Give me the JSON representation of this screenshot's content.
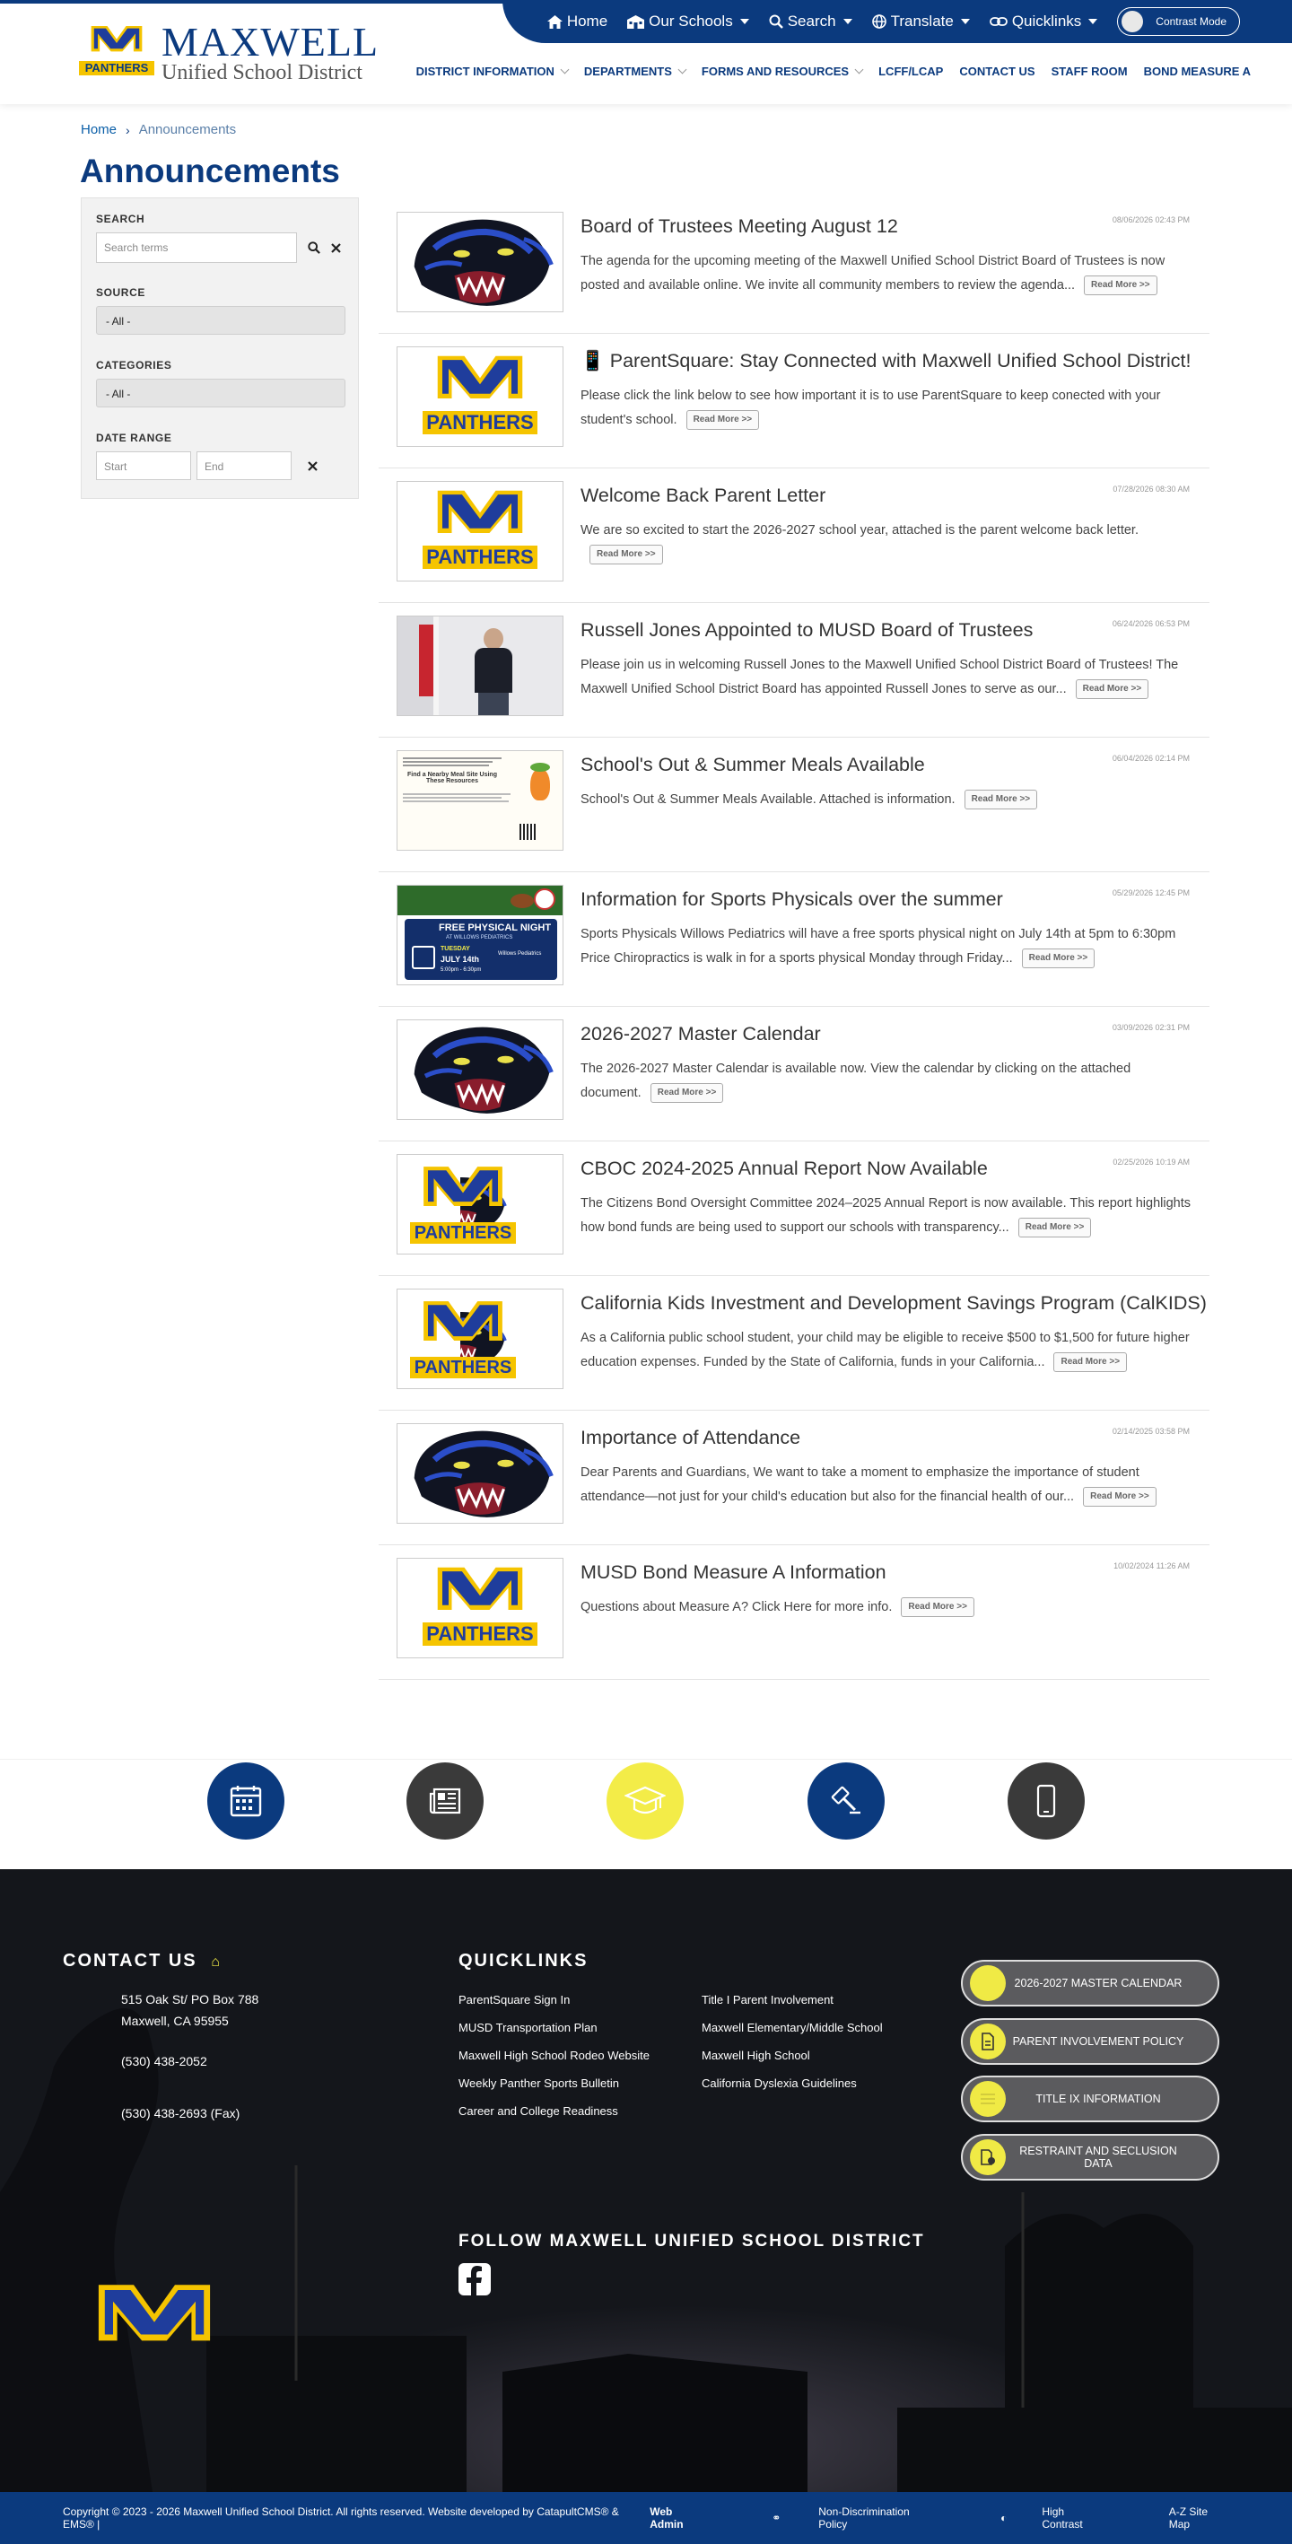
{
  "header": {
    "logo_name": "MAXWELL",
    "logo_sub": "Unified School District",
    "logo_letter": "M",
    "logo_word": "PANTHERS",
    "util": [
      "Home",
      "Our Schools",
      "Search",
      "Translate",
      "Quicklinks"
    ],
    "contrast": "Contrast Mode",
    "nav": [
      "DISTRICT INFORMATION",
      "DEPARTMENTS",
      "FORMS AND RESOURCES",
      "LCFF/LCAP",
      "CONTACT US",
      "STAFF ROOM",
      "BOND MEASURE A"
    ]
  },
  "breadcrumb": {
    "home": "Home",
    "current": "Announcements"
  },
  "page_title": "Announcements",
  "sidebar": {
    "search_label": "SEARCH",
    "search_placeholder": "Search terms",
    "source_label": "SOURCE",
    "source_value": "- All -",
    "categories_label": "CATEGORIES",
    "categories_value": "- All -",
    "date_label": "DATE RANGE",
    "start_placeholder": "Start",
    "end_placeholder": "End"
  },
  "read_more": "Read More >>",
  "items": [
    {
      "title": "Board of Trustees Meeting August 12",
      "date": "08/06/2026 02:43 PM",
      "excerpt": "The agenda for the upcoming meeting of the Maxwell Unified School District Board of Trustees is now posted and available online. We invite all community members to review the agenda...",
      "thumb": "panther"
    },
    {
      "title": "📱 ParentSquare: Stay Connected with Maxwell Unified School District!",
      "date": "",
      "excerpt": "Please click the link below to see how important it is to use ParentSquare to keep conected with your student's school.",
      "thumb": "logo"
    },
    {
      "title": "Welcome Back Parent Letter",
      "date": "07/28/2026 08:30 AM",
      "excerpt": "We are so excited to start the 2026-2027 school year, attached is the parent welcome back letter.",
      "thumb": "logo"
    },
    {
      "title": "Russell Jones Appointed to MUSD Board of Trustees",
      "date": "06/24/2026 06:53 PM",
      "excerpt": "Please join us in welcoming Russell Jones to the Maxwell Unified School District Board of Trustees! The Maxwell Unified School District Board has appointed Russell Jones to serve as our...",
      "thumb": "photo"
    },
    {
      "title": "School's Out & Summer Meals Available",
      "date": "06/04/2026 02:14 PM",
      "excerpt": "School's Out & Summer Meals Available. Attached is information.",
      "thumb": "flyer"
    },
    {
      "title": "Information for Sports Physicals over the summer",
      "date": "05/29/2026 12:45 PM",
      "excerpt": "Sports Physicals  Willows Pediatrics will have a free sports physical night on July 14th at 5pm to 6:30pm   Price Chiropractics is walk in for a sports physical Monday through Friday...",
      "thumb": "sports"
    },
    {
      "title": "2026-2027 Master Calendar",
      "date": "03/09/2026 02:31 PM",
      "excerpt": "The 2026-2027 Master Calendar is available now. View the calendar by clicking on the attached document.",
      "thumb": "panther"
    },
    {
      "title": "CBOC 2024-2025 Annual Report Now Available",
      "date": "02/25/2026 10:19 AM",
      "excerpt": "The Citizens Bond Oversight Committee 2024–2025 Annual Report is now available. This report highlights how bond funds are being used to support our schools with transparency...",
      "thumb": "logopanther"
    },
    {
      "title": "California Kids Investment and Development Savings Program (CalKIDS)",
      "date": "",
      "excerpt": "As a California public school student, your child may be eligible to receive $500 to $1,500 for future higher education expenses. Funded by the State of California, funds in your California...",
      "thumb": "logopanther"
    },
    {
      "title": "Importance of Attendance",
      "date": "02/14/2025 03:58 PM",
      "excerpt": "Dear Parents and Guardians, We want to take a moment to emphasize the importance of student attendance—not just for your child's education but also for the financial health of our...",
      "thumb": "panther"
    },
    {
      "title": "MUSD Bond Measure A Information",
      "date": "10/02/2024 11:26 AM",
      "excerpt": "Questions about Measure A? Click Here for more info.",
      "thumb": "logo"
    }
  ],
  "thumb_text": {
    "flyer_head": "Find a Nearby Meal Site Using These Resources",
    "sports_banner": "FREE PHYSICAL NIGHT",
    "sports_sub": "AT WILLOWS PEDIATRICS",
    "sports_day": "TUESDAY",
    "sports_date": "JULY 14th",
    "sports_time": "5:00pm - 6:30pm",
    "sports_place": "Willows Pediatrics"
  },
  "circle_links": [
    {
      "icon": "calendar-icon",
      "color": "#0b3a7e"
    },
    {
      "icon": "newspaper-icon",
      "color": "#3a3a3a"
    },
    {
      "icon": "graduation-cap-icon",
      "color": "#f3ec48"
    },
    {
      "icon": "gavel-icon",
      "color": "#0b3a7e"
    },
    {
      "icon": "mobile-icon",
      "color": "#3a3a3a"
    }
  ],
  "footer": {
    "contact_heading": "CONTACT US",
    "address1": "515 Oak St/ PO Box 788",
    "address2": "Maxwell, CA 95955",
    "phone": "(530) 438-2052",
    "fax": "(530) 438-2693 (Fax)",
    "quicklinks_heading": "QUICKLINKS",
    "quicklinks_col1": [
      "ParentSquare Sign In",
      "MUSD Transportation Plan",
      "Maxwell High School Rodeo Website",
      "Weekly Panther Sports Bulletin",
      "Career and College Readiness"
    ],
    "quicklinks_col2": [
      "Title I Parent Involvement",
      "Maxwell Elementary/Middle School",
      "Maxwell High School",
      "California Dyslexia Guidelines"
    ],
    "buttons": [
      "2026-2027 MASTER CALENDAR",
      "PARENT INVOLVEMENT POLICY",
      "TITLE IX INFORMATION",
      "RESTRAINT AND SECLUSION DATA"
    ],
    "follow_heading": "FOLLOW MAXWELL UNIFIED SCHOOL DISTRICT",
    "copyright": "Copyright © 2023 - 2026 Maxwell Unified School District. All rights reserved. Website developed by CatapultCMS® & EMS® |",
    "web_admin": "Web Admin",
    "nondiscrimination": "Non-Discrimination Policy",
    "high_contrast": "High Contrast",
    "sitemap": "A-Z Site Map"
  },
  "colors": {
    "navy": "#0b3a7e",
    "yellow": "#f3ec48",
    "gold": "#f5c400"
  }
}
